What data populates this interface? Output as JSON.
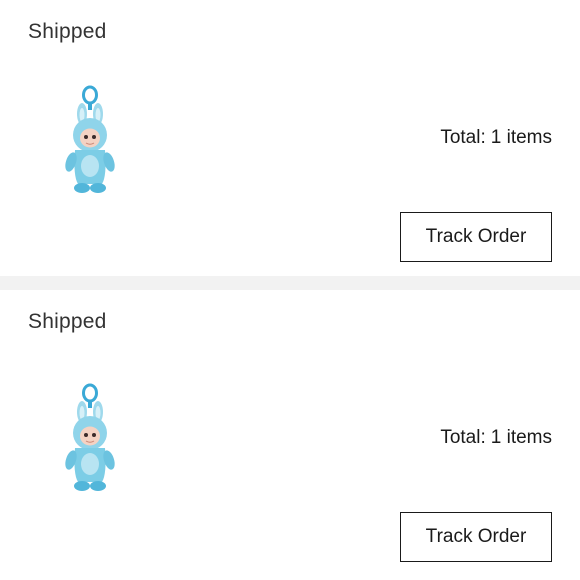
{
  "orders": [
    {
      "status": "Shipped",
      "product_image": "labubu-blue-bunny-plush-keychain",
      "total_label": "Total:",
      "total_value": "1 items",
      "track_label": "Track Order"
    },
    {
      "status": "Shipped",
      "product_image": "labubu-blue-bunny-plush-keychain",
      "total_label": "Total:",
      "total_value": "1 items",
      "track_label": "Track Order"
    }
  ],
  "colors": {
    "plush_blue": "#7ccde6",
    "plush_light": "#b8e4f2",
    "keyring": "#3aa9d6",
    "divider": "#f2f2f2"
  }
}
